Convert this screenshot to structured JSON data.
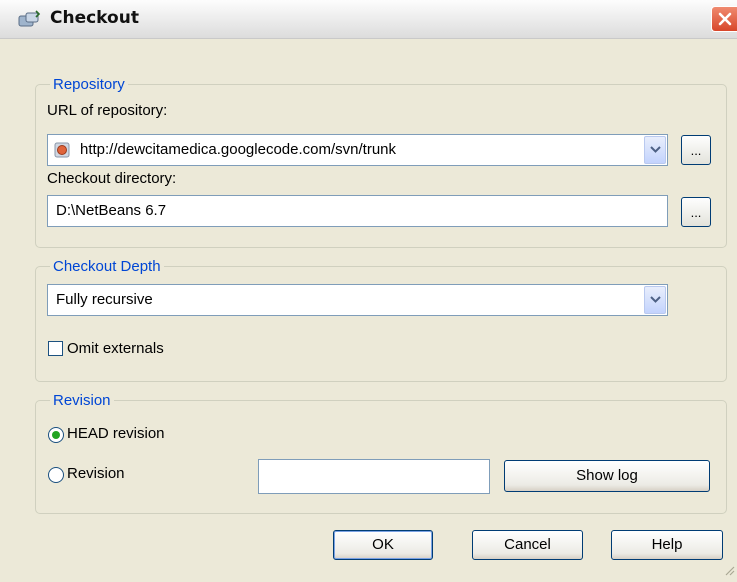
{
  "window": {
    "title": "Checkout"
  },
  "repository": {
    "legend": "Repository",
    "url_label": "URL of repository:",
    "url_value": "http://dewcitamedica.googlecode.com/svn/trunk",
    "browse_label": "...",
    "dir_label": "Checkout directory:",
    "dir_value": "D:\\NetBeans 6.7",
    "dir_browse_label": "..."
  },
  "depth": {
    "legend": "Checkout Depth",
    "selected": "Fully recursive",
    "omit_externals_label": "Omit externals",
    "omit_externals_checked": false
  },
  "revision": {
    "legend": "Revision",
    "head_label": "HEAD revision",
    "head_selected": true,
    "revision_label": "Revision",
    "revision_value": "",
    "show_log_label": "Show log"
  },
  "footer": {
    "ok_label": "OK",
    "cancel_label": "Cancel",
    "help_label": "Help"
  },
  "colors": {
    "legend": "#0046d5",
    "dialog_bg": "#ece9d8",
    "close": "#d8462a",
    "radio_dot": "#22a422"
  }
}
